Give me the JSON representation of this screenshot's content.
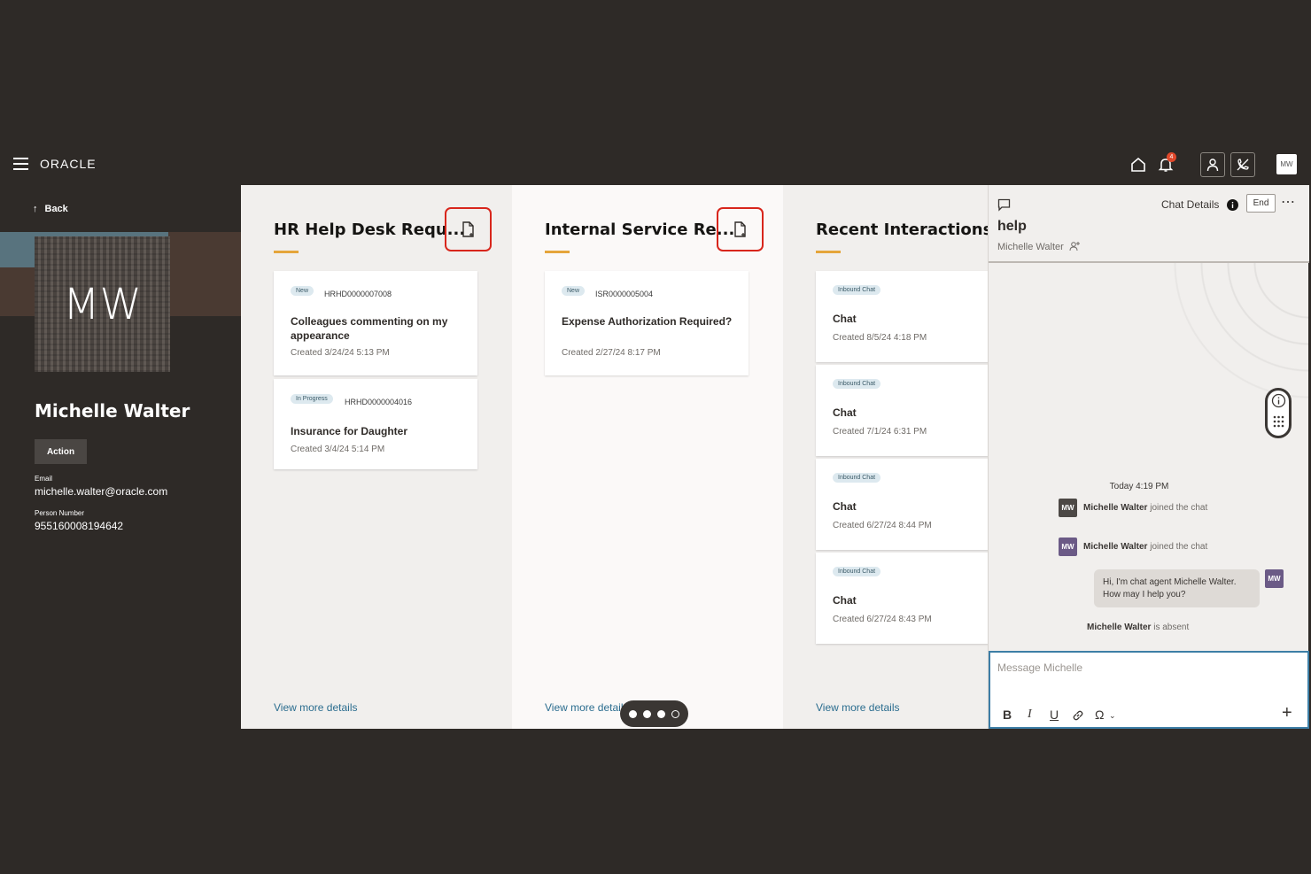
{
  "header": {
    "brand": "ORACLE",
    "notification_count": "4",
    "user_initials": "MW"
  },
  "profile": {
    "back_label": "Back",
    "initials": "MW",
    "name": "Michelle Walter",
    "action_label": "Action",
    "email_label": "Email",
    "email": "michelle.walter@oracle.com",
    "person_number_label": "Person Number",
    "person_number": "955160008194642"
  },
  "hr_column": {
    "title": "HR Help Desk Requ...",
    "view_more": "View more details",
    "cards": [
      {
        "status": "New",
        "ref": "HRHD0000007008",
        "title": "Colleagues commenting on my appearance",
        "created": "Created 3/24/24 5:13 PM"
      },
      {
        "status": "In Progress",
        "ref": "HRHD0000004016",
        "title": "Insurance for Daughter",
        "created": "Created 3/4/24 5:14 PM"
      }
    ]
  },
  "isr_column": {
    "title": "Internal Service Re...",
    "view_more": "View more details",
    "cards": [
      {
        "status": "New",
        "ref": "ISR0000005004",
        "title": "Expense Authorization Required?",
        "created": "Created 2/27/24 8:17 PM"
      }
    ]
  },
  "interactions_column": {
    "title": "Recent Interactions",
    "view_more": "View more details",
    "items": [
      {
        "badge": "Inbound Chat",
        "title": "Chat",
        "created": "Created 8/5/24 4:18 PM"
      },
      {
        "badge": "Inbound Chat",
        "title": "Chat",
        "created": "Created 7/1/24 6:31 PM"
      },
      {
        "badge": "Inbound Chat",
        "title": "Chat",
        "created": "Created 6/27/24 8:44 PM"
      },
      {
        "badge": "Inbound Chat",
        "title": "Chat",
        "created": "Created 6/27/24 8:43 PM"
      }
    ]
  },
  "chat": {
    "details_label": "Chat Details",
    "end_label": "End",
    "title": "help",
    "subtitle": "Michelle Walter",
    "timestamp": "Today 4:19 PM",
    "events": [
      {
        "name": "Michelle Walter",
        "text": "joined the chat"
      },
      {
        "name": "Michelle Walter",
        "text": "joined the chat"
      }
    ],
    "message": "Hi, I'm chat agent Michelle Walter. How may I help you?",
    "absent_name": "Michelle Walter",
    "absent_text": "is absent",
    "avatar_initials": "MW",
    "input_placeholder": "Message Michelle"
  },
  "colors": {
    "accent_underline": "#e5a53b",
    "highlight_red": "#d8261c",
    "link": "#2b6d8f",
    "dark_bg": "#2e2a27"
  }
}
